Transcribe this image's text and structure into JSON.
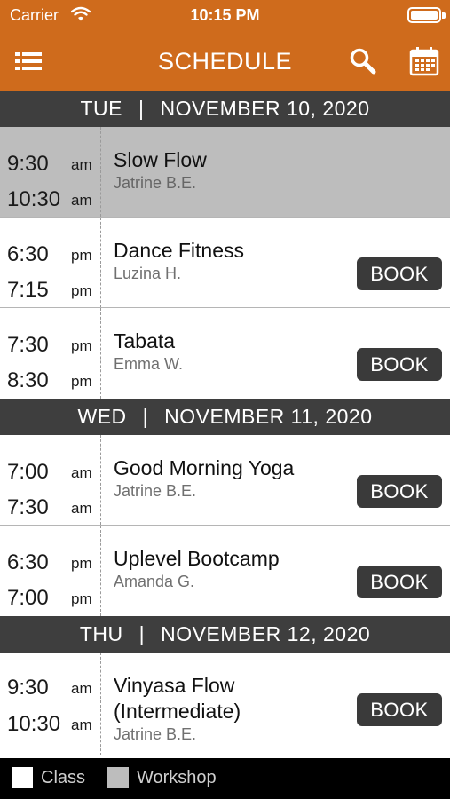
{
  "status_bar": {
    "carrier": "Carrier",
    "time": "10:15 PM"
  },
  "nav": {
    "title": "SCHEDULE",
    "left_icon": "list-menu-icon",
    "right_icons": [
      "search-icon",
      "calendar-icon"
    ]
  },
  "colors": {
    "nav_bg": "#cf6b1c",
    "header_bg": "#3e3e3e",
    "workshop_bg": "#bdbdbd",
    "book_bg": "#3a3a3a"
  },
  "days": [
    {
      "weekday": "TUE",
      "separator": "|",
      "date": "NOVEMBER 10, 2020",
      "classes": [
        {
          "start_time": "9:30",
          "start_ampm": "am",
          "end_time": "10:30",
          "end_ampm": "am",
          "name": "Slow Flow",
          "instructor": "Jatrine B.E.",
          "type": "workshop",
          "book_label": ""
        },
        {
          "start_time": "6:30",
          "start_ampm": "pm",
          "end_time": "7:15",
          "end_ampm": "pm",
          "name": "Dance Fitness",
          "instructor": "Luzina  H.",
          "type": "class",
          "book_label": "BOOK"
        },
        {
          "start_time": "7:30",
          "start_ampm": "pm",
          "end_time": "8:30",
          "end_ampm": "pm",
          "name": "Tabata",
          "instructor": "Emma W.",
          "type": "class",
          "book_label": "BOOK"
        }
      ]
    },
    {
      "weekday": "WED",
      "separator": "|",
      "date": "NOVEMBER 11, 2020",
      "classes": [
        {
          "start_time": "7:00",
          "start_ampm": "am",
          "end_time": "7:30",
          "end_ampm": "am",
          "name": "Good Morning Yoga",
          "instructor": "Jatrine B.E.",
          "type": "class",
          "book_label": "BOOK"
        },
        {
          "start_time": "6:30",
          "start_ampm": "pm",
          "end_time": "7:00",
          "end_ampm": "pm",
          "name": "Uplevel Bootcamp",
          "instructor": "Amanda G.",
          "type": "class",
          "book_label": "BOOK"
        }
      ]
    },
    {
      "weekday": "THU",
      "separator": "|",
      "date": "NOVEMBER 12, 2020",
      "classes": [
        {
          "start_time": "9:30",
          "start_ampm": "am",
          "end_time": "10:30",
          "end_ampm": "am",
          "name_line1": "Vinyasa Flow",
          "name_line2": "(Intermediate)",
          "instructor": "Jatrine B.E.",
          "type": "class",
          "book_label": "BOOK"
        }
      ]
    }
  ],
  "legend": {
    "class_label": "Class",
    "workshop_label": "Workshop"
  }
}
